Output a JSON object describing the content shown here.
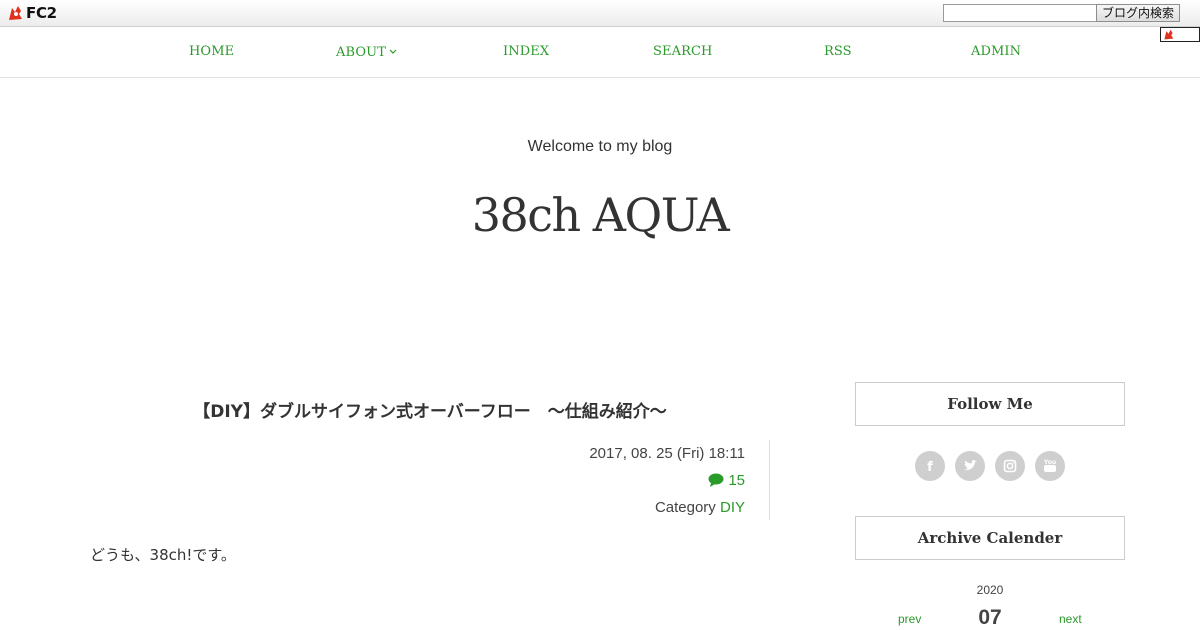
{
  "fc2bar": {
    "brand": "FC2",
    "search_value": "",
    "search_button": "ブログ内検索"
  },
  "nav": {
    "items": [
      {
        "label": "HOME"
      },
      {
        "label": "ABOUT"
      },
      {
        "label": "INDEX"
      },
      {
        "label": "SEARCH"
      },
      {
        "label": "RSS"
      },
      {
        "label": "ADMIN"
      }
    ]
  },
  "header": {
    "tagline": "Welcome to my blog",
    "title": "38ch AQUA"
  },
  "post": {
    "title": "【DIY】ダブルサイフォン式オーバーフロー　～仕組み紹介～",
    "date": "2017, 08. 25 (Fri) 18:11",
    "comment_count": "15",
    "category_label": "Category ",
    "category": "DIY",
    "body": "どうも、38ch!です。"
  },
  "sidebar": {
    "follow_title": "Follow Me",
    "social_icons": [
      "facebook-icon",
      "twitter-icon",
      "instagram-icon",
      "youtube-icon"
    ],
    "archive_title": "Archive Calender",
    "calendar": {
      "year": "2020",
      "prev": "prev",
      "month": "07",
      "next": "next"
    }
  },
  "colors": {
    "accent": "#2a9a2a",
    "text": "#333333",
    "social": "#cfcfcf"
  }
}
